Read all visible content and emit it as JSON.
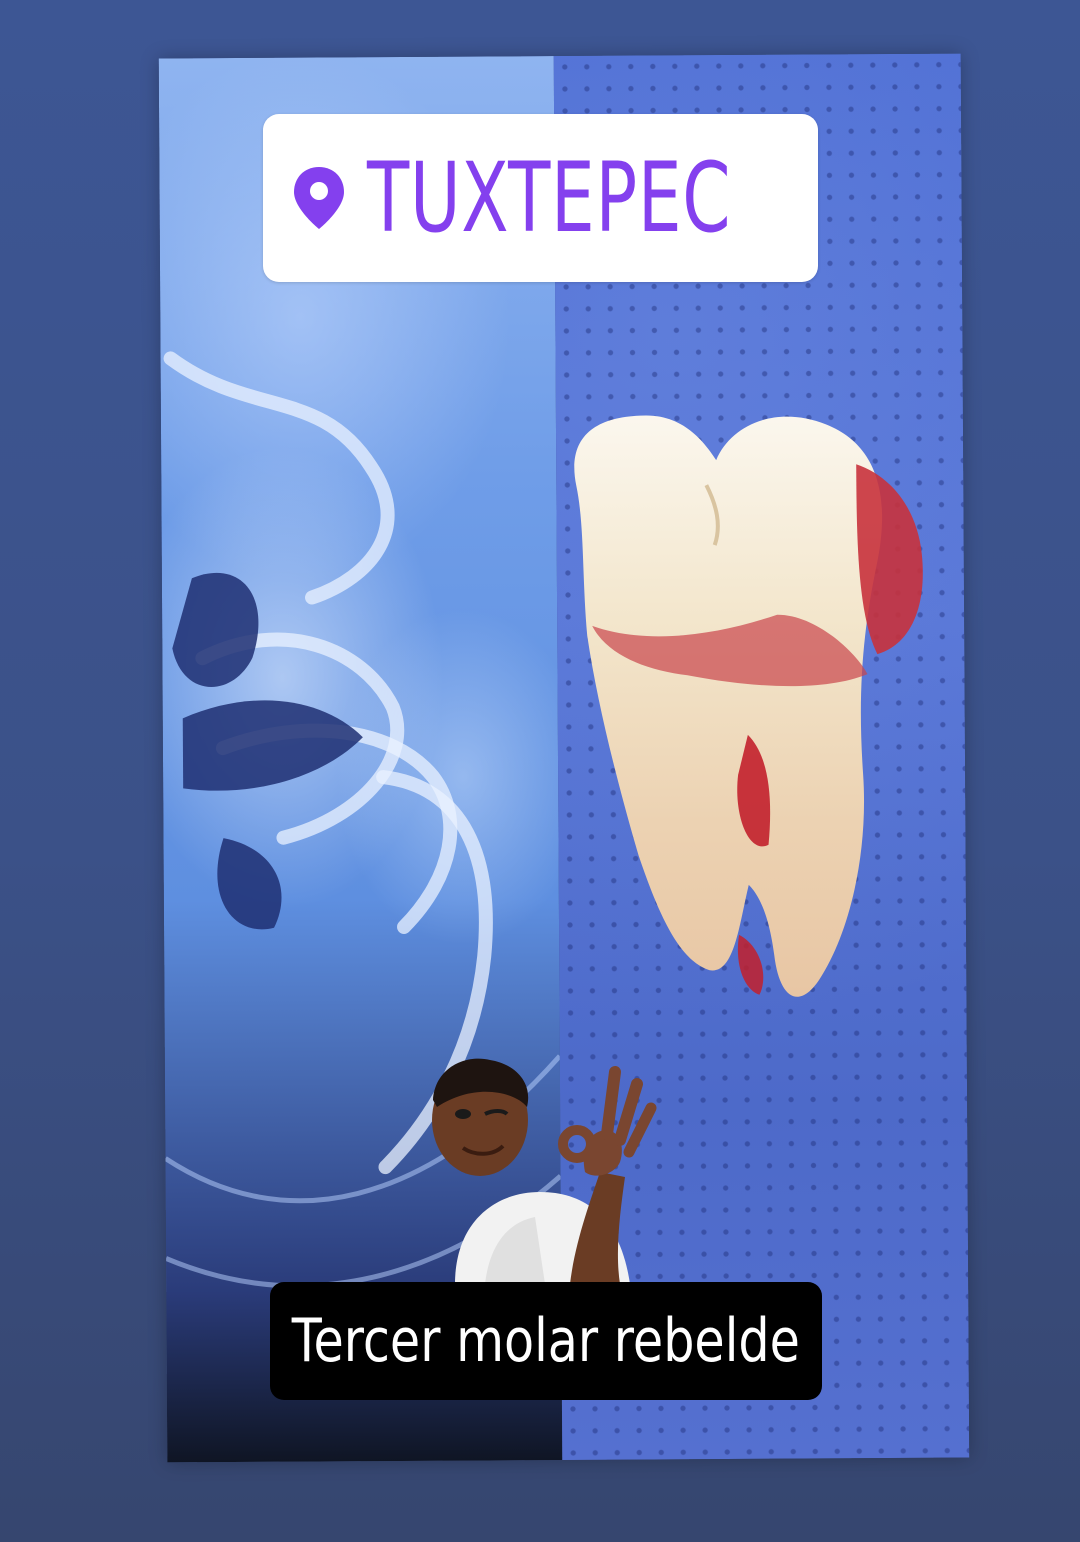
{
  "location_sticker": {
    "text": "TUXTEPEC",
    "icon": "location-pin-icon",
    "color": "#8440ee"
  },
  "caption": {
    "text": "Tercer molar rebelde"
  },
  "images": {
    "left": "x-ray",
    "right": "extracted-tooth-on-drape",
    "avatar": "cartoon-man-ok-gesture"
  }
}
